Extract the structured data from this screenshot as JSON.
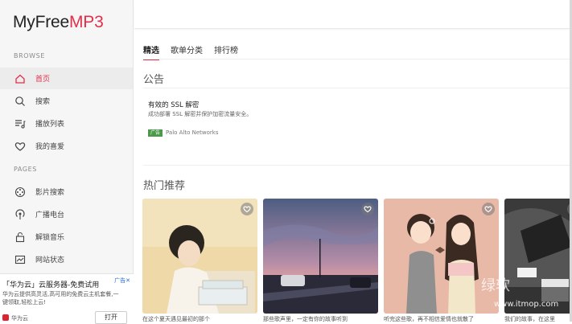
{
  "logo": {
    "main": "MyFree",
    "accent": "MP3"
  },
  "sidebar": {
    "browse_title": "BROWSE",
    "pages_title": "PAGES",
    "items": [
      {
        "label": "首页",
        "icon": "home-icon"
      },
      {
        "label": "搜索",
        "icon": "search-icon"
      },
      {
        "label": "播放列表",
        "icon": "playlist-icon"
      },
      {
        "label": "我的喜爱",
        "icon": "heart-icon"
      },
      {
        "label": "影片搜索",
        "icon": "film-reel-icon"
      },
      {
        "label": "广播电台",
        "icon": "radio-icon"
      },
      {
        "label": "解锁音乐",
        "icon": "lock-icon"
      },
      {
        "label": "网站状态",
        "icon": "status-icon"
      }
    ],
    "ad": {
      "title": "「华为云」云服务器-免费试用",
      "tag": "广告✕",
      "desc": "华为云提供高灵活,高可用的免费云主机套餐,一键领取,轻松上云!",
      "brand": "华为云",
      "open": "打开"
    }
  },
  "tabs": [
    "精选",
    "歌单分类",
    "排行榜"
  ],
  "notice": {
    "title": "公告",
    "ad_title": "有效的 SSL 解密",
    "ad_desc": "成功部署 SSL 解密并保护加密流量安全。",
    "ad_tag": "广告",
    "ad_source": "Palo Alto Networks"
  },
  "hot": {
    "title": "热门推荐",
    "captions": [
      "在这个夏天遇见最初的那个",
      "那些歌声里，一定有你的故事听到",
      "听完这些歌，再不相信爱情也就散了",
      "我们的故事，在这里"
    ]
  },
  "watermark": {
    "cn": "绿软",
    "url": "www.itmop.com"
  }
}
